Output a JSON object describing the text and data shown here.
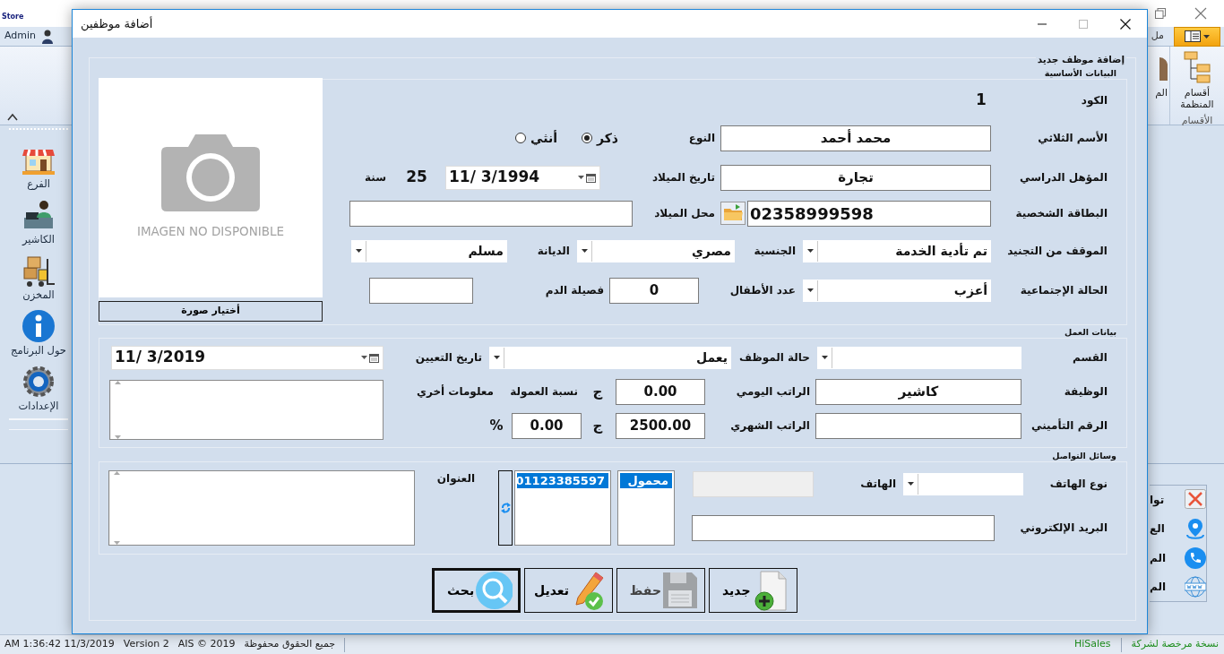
{
  "app": {
    "logo": "Store",
    "user": "Admin",
    "ribbon_tabs": [
      {
        "label": "مل",
        "selected": false
      }
    ],
    "ribbon_partial": "الم",
    "ribbon_button": "أقسام المنظمة",
    "ribbon_group": "الأقسام",
    "sidebar": [
      {
        "label": "الفرع",
        "kind": "store"
      },
      {
        "label": "الكاشير",
        "kind": "cashier"
      },
      {
        "label": "المخزن",
        "kind": "warehouse"
      },
      {
        "label": "حول البرنامج",
        "kind": "info"
      },
      {
        "label": "الإعدادات",
        "kind": "settings"
      }
    ],
    "side_panel": [
      {
        "label": "توا",
        "kind": "close"
      },
      {
        "label": "الع",
        "kind": "location"
      },
      {
        "label": "الم",
        "kind": "phone"
      },
      {
        "label": "الم",
        "kind": "web"
      }
    ],
    "status_bar": {
      "left": [
        "جميع الحقوق محفوظة",
        "AIS © 2019",
        "Version 2",
        "AM 1:36:42 11/3/2019"
      ],
      "right": [
        "نسخة مرخصة لشركة",
        "HiSales"
      ]
    }
  },
  "dialog": {
    "title": "أضافة موظفين",
    "heading": "إضافة موظف جديد",
    "basic": {
      "title": "البيانات الأساسية",
      "rows": [
        {
          "items": [
            {
              "kind": "label",
              "text": "الكود"
            },
            {
              "kind": "value",
              "text": "1"
            }
          ]
        },
        {
          "items": [
            {
              "kind": "label",
              "text": "الأسم الثلاثي"
            },
            {
              "kind": "input",
              "value": "محمد أحمد"
            },
            {
              "kind": "label",
              "text": "النوع"
            },
            {
              "kind": "radio",
              "text": "ذكر",
              "selected": true
            },
            {
              "kind": "radio",
              "text": "أنثي",
              "selected": false
            }
          ]
        },
        {
          "items": [
            {
              "kind": "label",
              "text": "المؤهل الدراسي"
            },
            {
              "kind": "input",
              "value": "تجارة"
            },
            {
              "kind": "label",
              "text": "تاريخ الميلاد"
            },
            {
              "kind": "date",
              "value": "11/ 3/1994"
            },
            {
              "kind": "value",
              "text": "25"
            },
            {
              "kind": "label",
              "text": "سنة"
            }
          ]
        },
        {
          "items": [
            {
              "kind": "label",
              "text": "البطاقة الشخصية"
            },
            {
              "kind": "input",
              "value": "02358999598"
            },
            {
              "kind": "folder_button"
            },
            {
              "kind": "label",
              "text": "محل الميلاد"
            },
            {
              "kind": "input"
            }
          ]
        },
        {
          "items": [
            {
              "kind": "label",
              "text": "الموقف من التجنيد"
            },
            {
              "kind": "combo",
              "value": "تم تأدية الخدمة"
            },
            {
              "kind": "label",
              "text": "الجنسية"
            },
            {
              "kind": "combo",
              "value": "مصري"
            },
            {
              "kind": "label",
              "text": "الديانة"
            },
            {
              "kind": "combo",
              "value": "مسلم"
            }
          ]
        },
        {
          "items": [
            {
              "kind": "label",
              "text": "الحالة الإجتماعية"
            },
            {
              "kind": "combo",
              "value": "أعزب"
            },
            {
              "kind": "label",
              "text": "عدد الأطفال"
            },
            {
              "kind": "input",
              "value": "0"
            },
            {
              "kind": "label",
              "text": "فصيلة الدم"
            },
            {
              "kind": "input"
            }
          ]
        }
      ],
      "photo": {
        "caption": "IMAGEN NO DISPONIBLE",
        "button": "أختيار صورة"
      }
    },
    "work": {
      "title": "بيانات العمل",
      "rows": [
        {
          "items": [
            {
              "kind": "label",
              "text": "القسم"
            },
            {
              "kind": "combo"
            },
            {
              "kind": "label",
              "text": "حالة الموظف"
            },
            {
              "kind": "combo",
              "value": "يعمل"
            },
            {
              "kind": "label",
              "text": "تاريخ التعيين"
            },
            {
              "kind": "date",
              "value": "11/ 3/2019"
            }
          ]
        },
        {
          "items": [
            {
              "kind": "label",
              "text": "الوظيفة"
            },
            {
              "kind": "input",
              "value": "كاشير"
            },
            {
              "kind": "label",
              "text": "الراتب اليومي"
            },
            {
              "kind": "input",
              "value": "0.00"
            },
            {
              "kind": "unit",
              "text": "ج"
            },
            {
              "kind": "label",
              "text": "نسبة العمولة"
            },
            {
              "kind": "label",
              "text": "معلومات أخري"
            }
          ]
        },
        {
          "items": [
            {
              "kind": "label",
              "text": "الرقم التأميني"
            },
            {
              "kind": "input"
            },
            {
              "kind": "label",
              "text": "الراتب الشهري"
            },
            {
              "kind": "input",
              "value": "2500.00"
            },
            {
              "kind": "unit",
              "text": "ج"
            },
            {
              "kind": "input",
              "value": "0.00"
            },
            {
              "kind": "unit",
              "text": "%"
            }
          ]
        }
      ]
    },
    "contact": {
      "title": "وسائل التواصل",
      "rows": [
        {
          "items": [
            {
              "kind": "label",
              "text": "نوع الهاتف"
            },
            {
              "kind": "combo"
            },
            {
              "kind": "label",
              "text": "الهاتف"
            },
            {
              "kind": "input",
              "disabled": true
            }
          ]
        },
        {
          "items": [
            {
              "kind": "label",
              "text": "البريد الإلكتروني"
            },
            {
              "kind": "input",
              "disabled": false
            }
          ]
        }
      ],
      "phone_types": [
        {
          "text": "محمول",
          "selected": true
        }
      ],
      "phone_numbers": [
        {
          "text": "01123385597",
          "selected": true
        }
      ],
      "address_label": "العنوان"
    },
    "buttons": [
      {
        "label": "جديد",
        "kind": "new",
        "disabled": false,
        "default": false
      },
      {
        "label": "حفظ",
        "kind": "save",
        "disabled": true,
        "default": false
      },
      {
        "label": "تعديل",
        "kind": "edit",
        "disabled": false,
        "default": false
      },
      {
        "label": "بحث",
        "kind": "search",
        "disabled": false,
        "default": true
      }
    ]
  }
}
